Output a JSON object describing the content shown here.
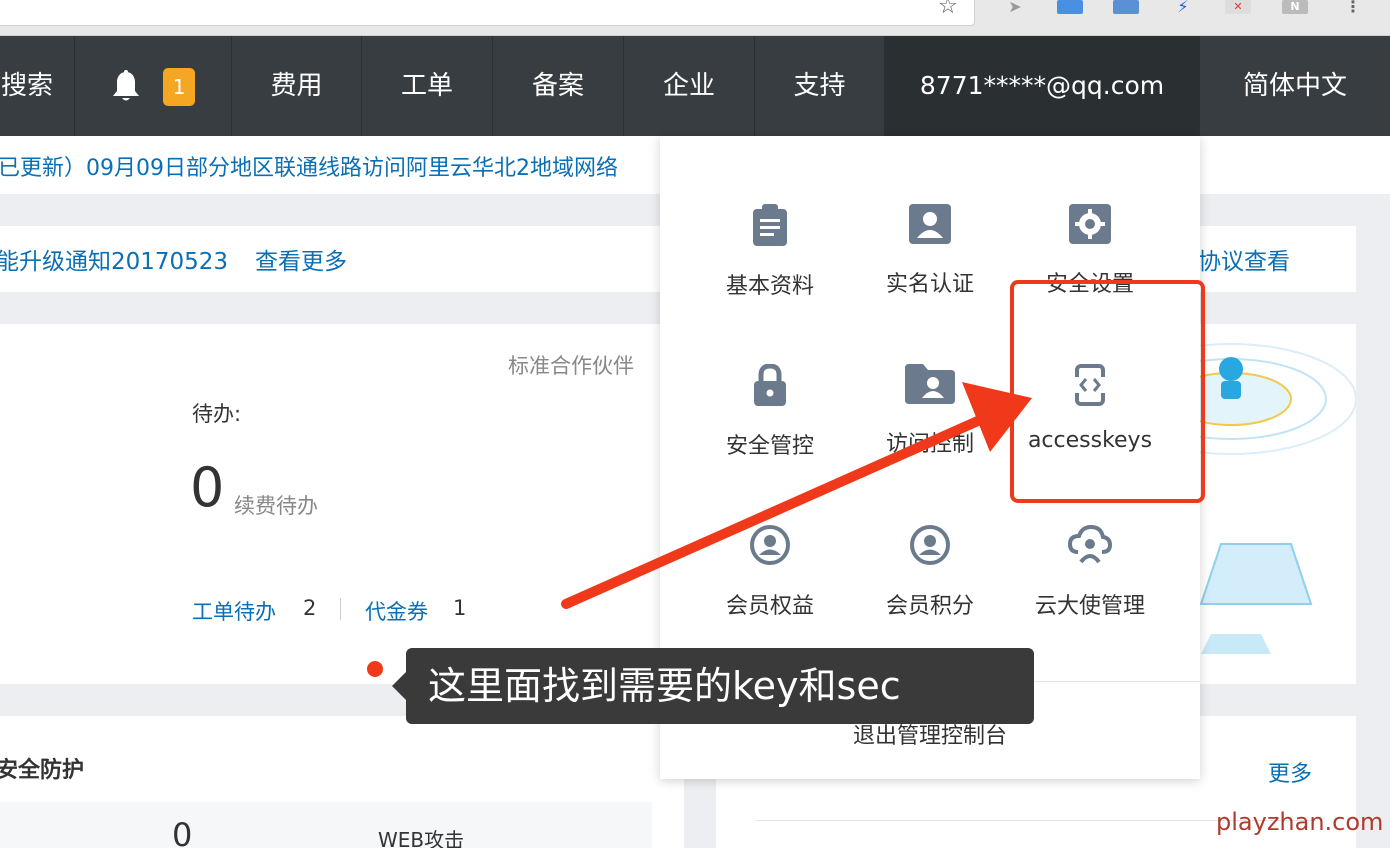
{
  "topnav": {
    "search_partial": "搜索",
    "notification_count": "1",
    "items": [
      "费用",
      "工单",
      "备案",
      "企业",
      "支持"
    ],
    "account": "8771*****@qq.com",
    "language": "简体中文"
  },
  "notice": {
    "text": "已更新）09月09日部分地区联通线路访问阿里云华北2地域网络"
  },
  "announcements": {
    "item": "能升级通知20170523",
    "more": "查看更多",
    "right_link": "协议查看"
  },
  "overview": {
    "partner_level": "标准合作伙伴",
    "todo_label": "待办:",
    "renew_count": "0",
    "renew_label": "续费待办",
    "ticket_label": "工单待办",
    "ticket_count": "2",
    "voucher_label": "代金券",
    "voucher_count": "1"
  },
  "security": {
    "title": "安全防护",
    "right_more": "更多",
    "bottom_zero": "0",
    "bottom_web": "WEB攻击"
  },
  "dropdown": {
    "items": [
      {
        "label": "基本资料",
        "icon": "clipboard-icon"
      },
      {
        "label": "实名认证",
        "icon": "id-card-icon"
      },
      {
        "label": "安全设置",
        "icon": "gear-icon"
      },
      {
        "label": "安全管控",
        "icon": "lock-icon"
      },
      {
        "label": "访问控制",
        "icon": "user-folder-icon"
      },
      {
        "label": "accesskeys",
        "icon": "code-device-icon"
      },
      {
        "label": "会员权益",
        "icon": "member-icon"
      },
      {
        "label": "会员积分",
        "icon": "member-points-icon"
      },
      {
        "label": "云大使管理",
        "icon": "cloud-user-icon"
      }
    ],
    "logout": "退出管理控制台"
  },
  "annotation": {
    "tooltip": "这里面找到需要的key和sec",
    "accent": "#f0391a"
  },
  "watermark": "playzhan.com"
}
